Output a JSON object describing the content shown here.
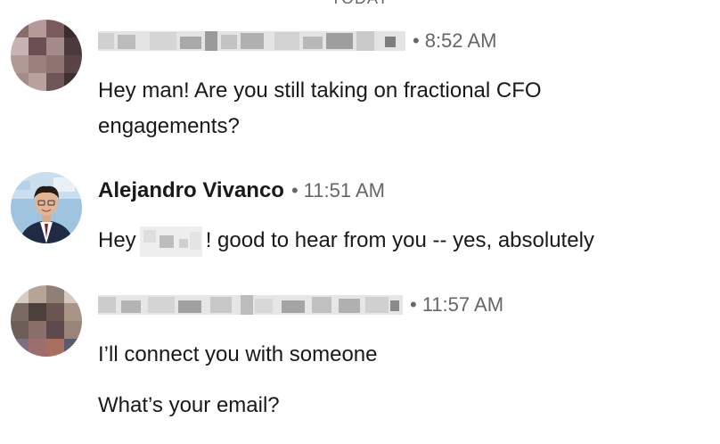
{
  "day_divider": "TODAY",
  "messages": [
    {
      "sender": "",
      "time": "8:52 AM",
      "lines": [
        "Hey man! Are you still taking on fractional CFO",
        "engagements?"
      ]
    },
    {
      "sender": "Alejandro Vivanco",
      "time": "11:51 AM",
      "text_before": "Hey",
      "text_after": "! good to hear from you -- yes, absolutely"
    },
    {
      "sender": "",
      "time": "11:57 AM",
      "lines": [
        "I’ll connect you with someone",
        "What’s your email?"
      ]
    }
  ],
  "colors": {
    "text": "#191919",
    "muted": "#666666",
    "background": "#ffffff"
  }
}
